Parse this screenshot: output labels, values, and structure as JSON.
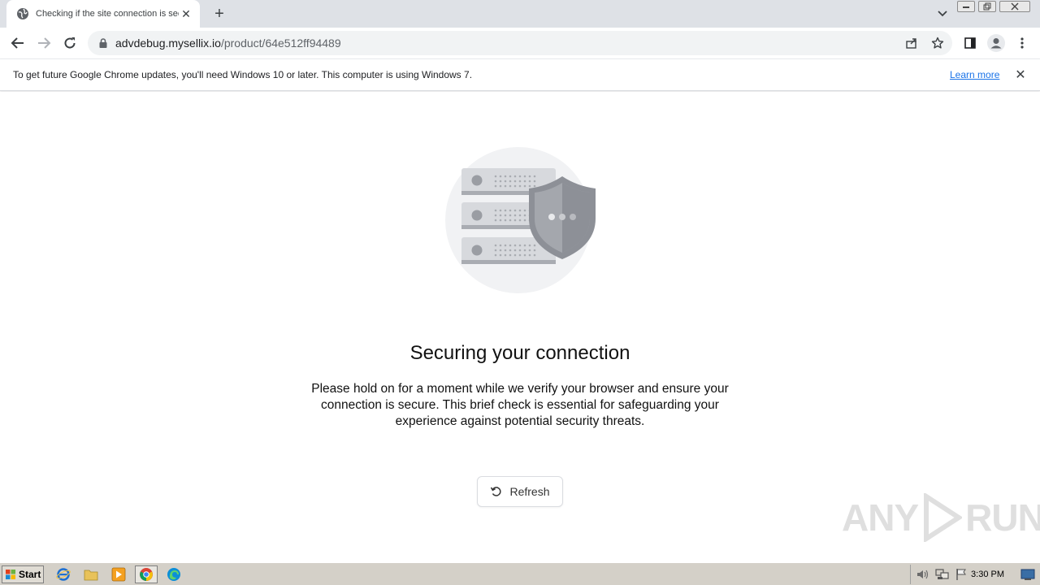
{
  "browser": {
    "tab_title": "Checking if the site connection is secure",
    "tab_close": "✕",
    "new_tab": "+",
    "url_host": "advdebug.mysellix.io",
    "url_path": "/product/64e512ff94489"
  },
  "infobar": {
    "message": "To get future Google Chrome updates, you'll need Windows 10 or later. This computer is using Windows 7.",
    "learn_more": "Learn more",
    "close": "✕"
  },
  "page": {
    "heading": "Securing your connection",
    "description": "Please hold on for a moment while we verify your browser and ensure your connection is secure. This brief check is essential for safeguarding your experience against potential security threats.",
    "refresh_label": "Refresh"
  },
  "watermark": {
    "left": "ANY",
    "right": "RUN"
  },
  "taskbar": {
    "start_label": "Start",
    "clock": "3:30 PM"
  },
  "colors": {
    "accent": "#1a73e8",
    "server_gray": "#c4c6cc",
    "shield_gray": "#8d9097"
  }
}
